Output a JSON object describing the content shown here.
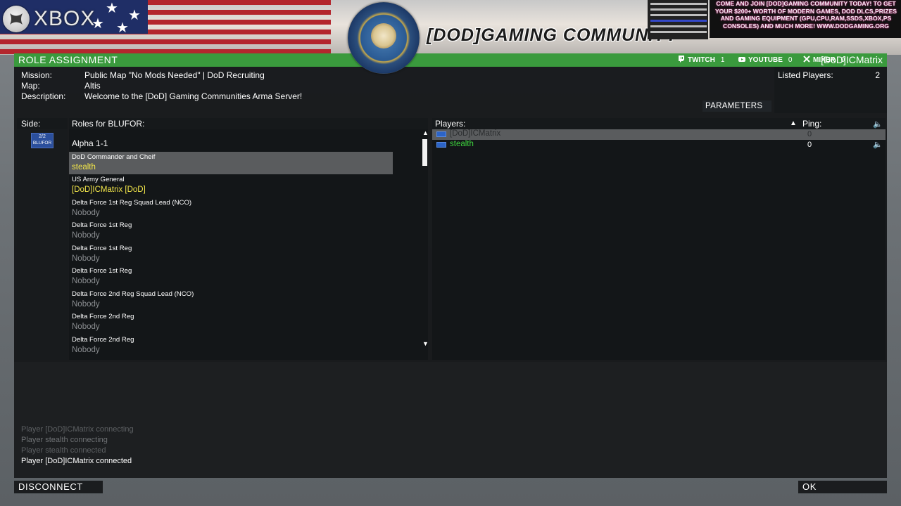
{
  "banner": {
    "xbox_text": "XBOX",
    "community_title": "[DOD]GAMING COMMUNITY",
    "promo_text": "COME AND JOIN [DOD]GAMING COMMUNITY TODAY! TO GET YOUR $200+ WORTH OF MODERN GAMES, DOD DLCS,PRIZES AND GAMING EQUIPMENT (GPU,CPU,RAM,SSDS,XBOX,PS CONSOLES) AND MUCH MORE! WWW.DODGAMING.ORG"
  },
  "header": {
    "title": "ROLE ASSIGNMENT",
    "user": "[DoD]ICMatrix",
    "streams": [
      {
        "label": "TWITCH",
        "count": "1",
        "icon": "twitch-icon"
      },
      {
        "label": "YOUTUBE",
        "count": "0",
        "icon": "youtube-icon"
      },
      {
        "label": "MIXER",
        "count": "0",
        "icon": "mixer-icon"
      }
    ]
  },
  "mission": {
    "mission_label": "Mission:",
    "mission_value": "Public Map \"No Mods Needed\" | DoD Recruiting",
    "map_label": "Map:",
    "map_value": "Altis",
    "description_label": "Description:",
    "description_value": "Welcome to the  [DoD] Gaming Communities Arma Server!",
    "parameters_button": "PARAMETERS"
  },
  "listed": {
    "label": "Listed Players:",
    "count": "2"
  },
  "sides": {
    "header": "Side:",
    "items": [
      {
        "count": "2/2",
        "name": "BLUFOR"
      }
    ]
  },
  "roles": {
    "header": "Roles for BLUFOR:",
    "group": "Alpha 1-1",
    "items": [
      {
        "role": "DoD Commander and Cheif",
        "player": "stealth"
      },
      {
        "role": "US Army General",
        "player": "[DoD]ICMatrix [DoD]"
      },
      {
        "role": "Delta Force 1st Reg Squad Lead (NCO)",
        "player": "Nobody"
      },
      {
        "role": "Delta Force 1st Reg",
        "player": "Nobody"
      },
      {
        "role": "Delta Force 1st Reg",
        "player": "Nobody"
      },
      {
        "role": "Delta Force 1st Reg",
        "player": "Nobody"
      },
      {
        "role": "Delta Force 2nd Reg Squad Lead (NCO)",
        "player": "Nobody"
      },
      {
        "role": "Delta Force 2nd Reg",
        "player": "Nobody"
      },
      {
        "role": "Delta Force 2nd Reg",
        "player": "Nobody"
      }
    ]
  },
  "players": {
    "header": "Players:",
    "ping_header": "Ping:",
    "rows": [
      {
        "name": "[DoD]ICMatrix",
        "ping": "0"
      },
      {
        "name": "stealth",
        "ping": "0"
      }
    ]
  },
  "log": [
    "Player [DoD]ICMatrix connecting",
    "Player stealth connecting",
    "Player stealth connected",
    "Player [DoD]ICMatrix connected"
  ],
  "buttons": {
    "disconnect": "DISCONNECT",
    "ok": "OK"
  },
  "colors": {
    "accent_green": "#3a9a3d",
    "assigned_yellow": "#f2e64a",
    "player_green": "#3ed43e",
    "selection_gray": "#5a5c5e"
  }
}
